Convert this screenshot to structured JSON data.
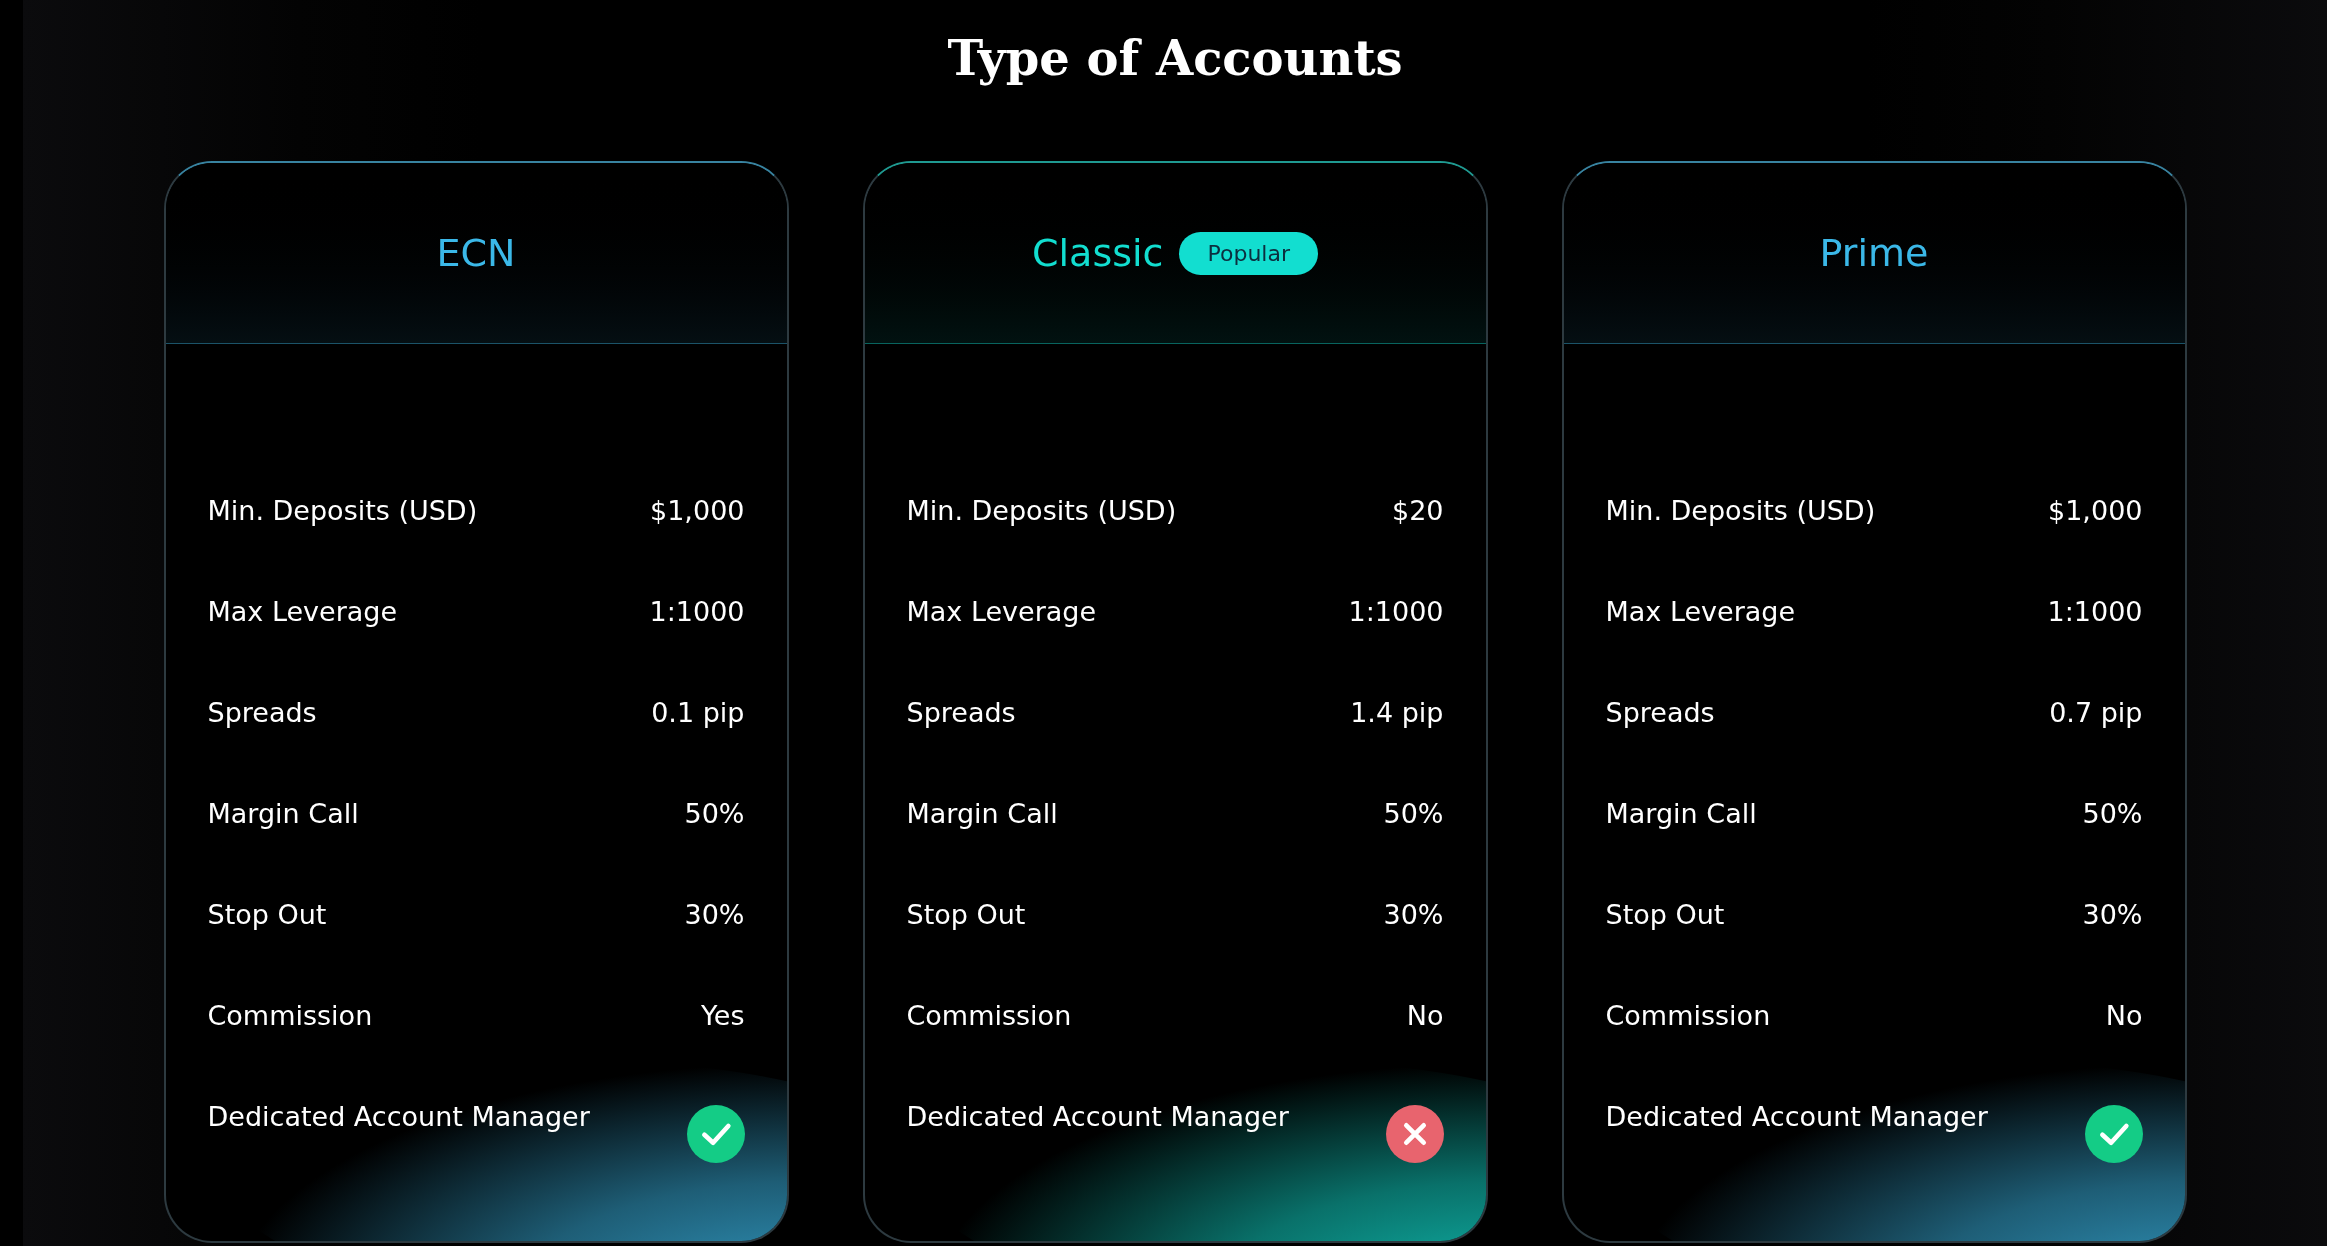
{
  "title": "Type of Accounts",
  "accounts": [
    {
      "name": "ECN",
      "color": "#3bb8e8",
      "rows": [
        {
          "label": "Min. Deposits (USD)",
          "value": "$1,000"
        },
        {
          "label": "Max Leverage",
          "value": "1:1000"
        },
        {
          "label": "Spreads",
          "value": "0.1 pip"
        },
        {
          "label": "Margin Call",
          "value": "50%"
        },
        {
          "label": "Stop Out",
          "value": "30%"
        },
        {
          "label": "Commission",
          "value": "Yes"
        }
      ],
      "manager": {
        "label": "Dedicated Account Manager",
        "included": true
      }
    },
    {
      "name": "Classic",
      "color": "#12ded0",
      "badge": "Popular",
      "rows": [
        {
          "label": "Min. Deposits (USD)",
          "value": "$20"
        },
        {
          "label": "Max Leverage",
          "value": "1:1000"
        },
        {
          "label": "Spreads",
          "value": "1.4 pip"
        },
        {
          "label": "Margin Call",
          "value": "50%"
        },
        {
          "label": "Stop Out",
          "value": "30%"
        },
        {
          "label": "Commission",
          "value": "No"
        }
      ],
      "manager": {
        "label": "Dedicated Account Manager",
        "included": false
      }
    },
    {
      "name": "Prime",
      "color": "#3bb8e8",
      "rows": [
        {
          "label": "Min. Deposits (USD)",
          "value": "$1,000"
        },
        {
          "label": "Max Leverage",
          "value": "1:1000"
        },
        {
          "label": "Spreads",
          "value": "0.7 pip"
        },
        {
          "label": "Margin Call",
          "value": "50%"
        },
        {
          "label": "Stop Out",
          "value": "30%"
        },
        {
          "label": "Commission",
          "value": "No"
        }
      ],
      "manager": {
        "label": "Dedicated Account Manager",
        "included": true
      }
    }
  ]
}
